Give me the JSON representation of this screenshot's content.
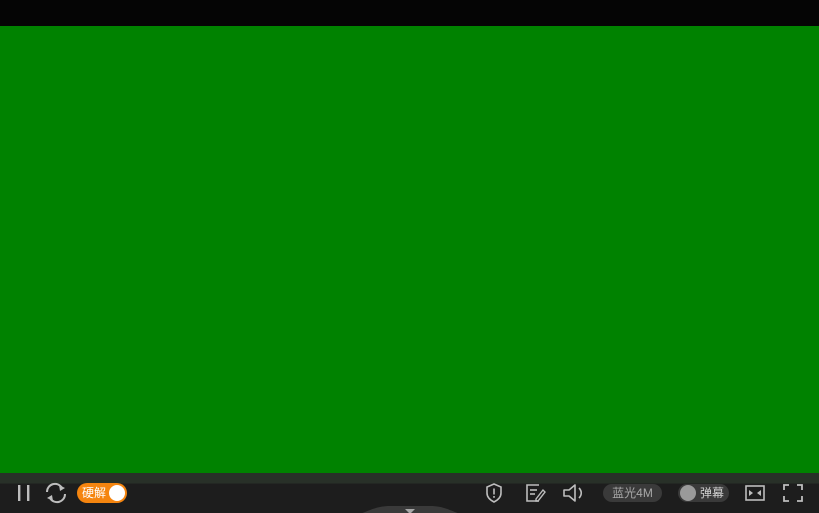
{
  "video": {
    "background_color": "#008200"
  },
  "controls": {
    "pause_icon": "pause-icon",
    "refresh_icon": "refresh-icon",
    "hardware_decode": {
      "label": "硬解",
      "enabled": true,
      "accent_color": "#f5850f"
    },
    "shield_icon": "shield-alert-icon",
    "notes_icon": "notes-edit-icon",
    "volume_icon": "volume-icon",
    "quality": {
      "label": "蓝光4M"
    },
    "danmaku": {
      "label": "弹幕",
      "enabled": false
    },
    "widescreen_icon": "widescreen-icon",
    "fullscreen_icon": "fullscreen-icon",
    "collapse_icon": "caret-down-icon"
  }
}
